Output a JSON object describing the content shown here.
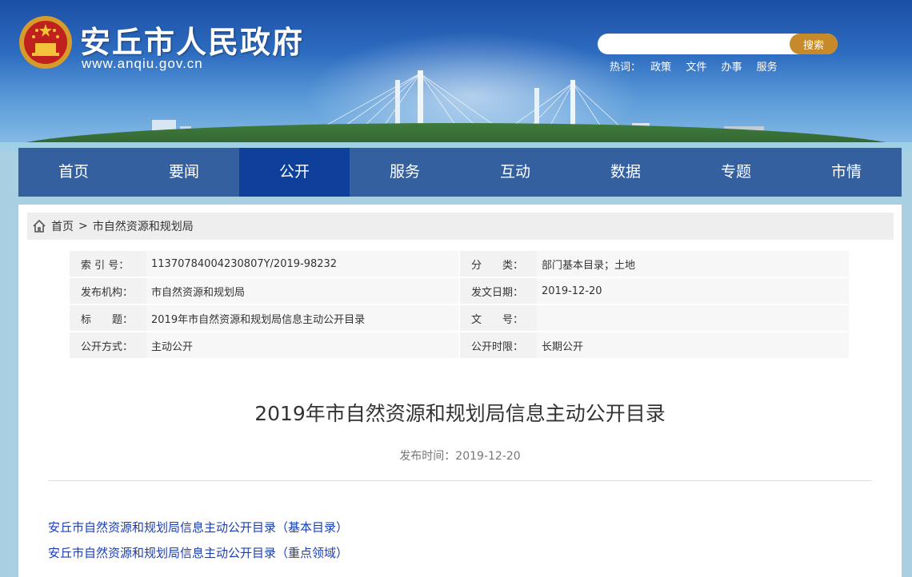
{
  "header": {
    "site_title": "安丘市人民政府",
    "site_url": "www.anqiu.gov.cn",
    "search_placeholder": "",
    "search_button": "搜索",
    "hotwords_label": "热词：",
    "hotwords": [
      "政策",
      "文件",
      "办事",
      "服务"
    ]
  },
  "nav": {
    "items": [
      "首页",
      "要闻",
      "公开",
      "服务",
      "互动",
      "数据",
      "专题",
      "市情"
    ],
    "active": "公开"
  },
  "breadcrumb": {
    "home": "首页",
    "separator": ">",
    "current": "市自然资源和规划局"
  },
  "meta": {
    "rows": [
      [
        {
          "k": "索 引 号：",
          "v": "11370784004230807Y/2019-98232"
        },
        {
          "k": "分　　类：",
          "v": "部门基本目录；土地"
        }
      ],
      [
        {
          "k": "发布机构：",
          "v": "市自然资源和规划局"
        },
        {
          "k": "发文日期：",
          "v": "2019-12-20"
        }
      ],
      [
        {
          "k": "标　　题：",
          "v": "2019年市自然资源和规划局信息主动公开目录"
        },
        {
          "k": "文　　号：",
          "v": ""
        }
      ],
      [
        {
          "k": "公开方式：",
          "v": "主动公开"
        },
        {
          "k": "公开时限：",
          "v": "长期公开"
        }
      ]
    ]
  },
  "article": {
    "title": "2019年市自然资源和规划局信息主动公开目录",
    "publish_time": "发布时间：2019-12-20",
    "links": [
      "安丘市自然资源和规划局信息主动公开目录（基本目录）",
      "安丘市自然资源和规划局信息主动公开目录（重点领域）"
    ]
  },
  "colors": {
    "nav_bg": "#3560a0",
    "nav_active": "#0e3f9a",
    "search_btn": "#c78a2b",
    "link": "#1a3fb4"
  }
}
